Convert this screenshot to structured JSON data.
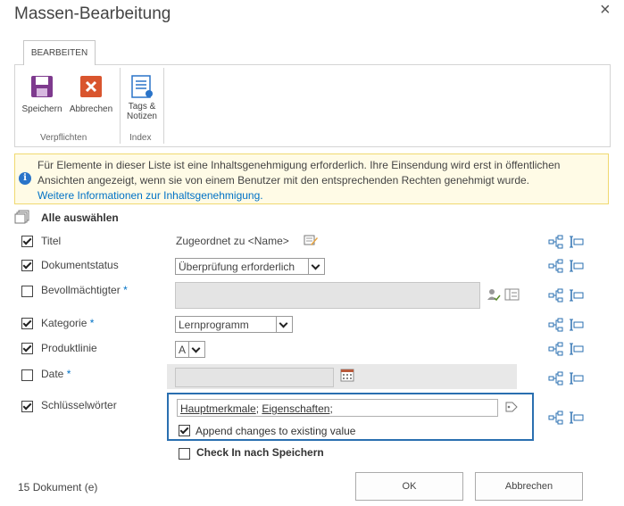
{
  "dialog": {
    "title": "Massen-Bearbeitung",
    "close_glyph": "×"
  },
  "ribbon": {
    "tab_label": "BEARBEITEN",
    "buttons": {
      "save": "Speichern",
      "cancel": "Abbrechen",
      "tags_line1": "Tags &",
      "tags_line2": "Notizen"
    },
    "groups": {
      "commit": "Verpflichten",
      "index": "Index"
    }
  },
  "notice": {
    "text": "Für Elemente in dieser Liste ist eine Inhaltsgenehmigung erforderlich. Ihre Einsendung wird erst in öffentlichen Ansichten angezeigt, wenn sie von einem Benutzer mit den entsprechenden Rechten genehmigt wurde.",
    "link": "Weitere Informationen zur Inhaltsgenehmigung."
  },
  "select_all": {
    "label": "Alle auswählen"
  },
  "fields": {
    "title": {
      "label": "Titel",
      "checked": true,
      "value": "Zugeordnet zu <Name>"
    },
    "doc_status": {
      "label": "Dokumentstatus",
      "checked": true,
      "value": "Überprüfung erforderlich"
    },
    "delegate": {
      "label": "Bevollmächtigter",
      "required_mark": "*",
      "checked": false
    },
    "category": {
      "label": "Kategorie",
      "required_mark": "*",
      "checked": true,
      "value": "Lernprogramm"
    },
    "product_line": {
      "label": "Produktlinie",
      "checked": true,
      "value": "A"
    },
    "date": {
      "label": "Date",
      "required_mark": "*",
      "checked": false
    },
    "keywords": {
      "label": "Schlüsselwörter",
      "checked": true,
      "term1": "Hauptmerkmale",
      "term2": "Eigenschaften",
      "sep": ";",
      "append_label": "Append changes to existing value",
      "append_checked": true
    }
  },
  "checkin": {
    "label": "Check In nach Speichern",
    "checked": false
  },
  "footer": {
    "count": "15",
    "count_label": "Dokument (e)",
    "ok": "OK",
    "cancel": "Abbrechen"
  },
  "colors": {
    "accent": "#0072c6",
    "focus_border": "#2a6fb0",
    "notice_bg": "#fffbe6",
    "save_icon": "#7e3a8e",
    "cancel_icon": "#d9552e"
  }
}
